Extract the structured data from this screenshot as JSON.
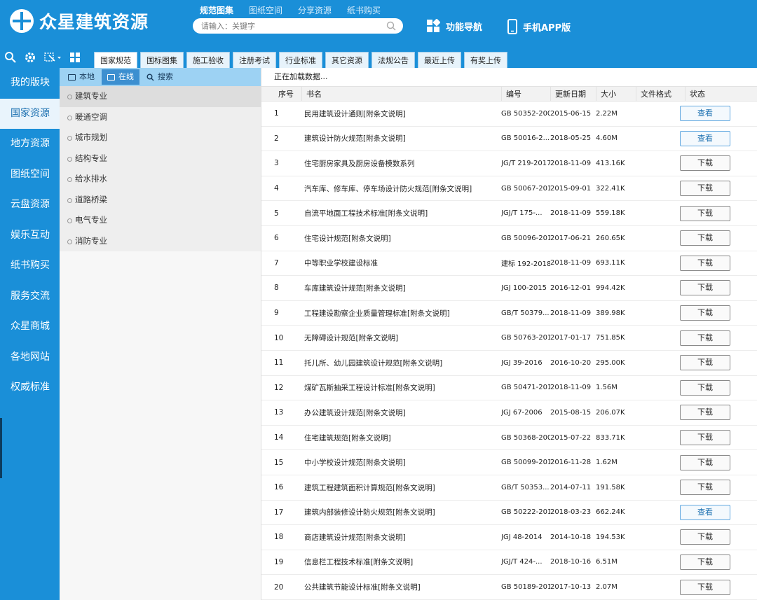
{
  "header": {
    "logo_text": "众星建筑资源",
    "search_tabs": [
      "规范图集",
      "图纸空间",
      "分享资源",
      "纸书购买"
    ],
    "search_placeholder": "请输入：关键字",
    "func_nav": "功能导航",
    "app_label": "手机APP版"
  },
  "tabs": [
    "国家规范",
    "国标图集",
    "施工验收",
    "注册考试",
    "行业标准",
    "其它资源",
    "法规公告",
    "最近上传",
    "有奖上传"
  ],
  "sidebar": [
    "我的版块",
    "国家资源",
    "地方资源",
    "图纸空间",
    "云盘资源",
    "娱乐互动",
    "纸书购买",
    "服务交流",
    "众星商城",
    "各地网站",
    "权威标准"
  ],
  "cat_tabs": [
    "本地",
    "在线",
    "搜索"
  ],
  "categories": [
    "建筑专业",
    "暖通空调",
    "城市规划",
    "结构专业",
    "给水排水",
    "道路桥梁",
    "电气专业",
    "消防专业"
  ],
  "loading_text": "正在加载数据...",
  "columns": [
    "序号",
    "书名",
    "编号",
    "更新日期",
    "大小",
    "文件格式",
    "状态"
  ],
  "rows": [
    {
      "no": "1",
      "name": "民用建筑设计通则[附条文说明]",
      "code": "GB 50352-2005",
      "date": "2015-06-15",
      "size": "2.22M",
      "action": "查看"
    },
    {
      "no": "2",
      "name": "建筑设计防火规范[附条文说明]",
      "code": "GB 50016-2...",
      "date": "2018-05-25",
      "size": "4.60M",
      "action": "查看"
    },
    {
      "no": "3",
      "name": "住宅厨房家具及厨房设备模数系列",
      "code": "JG/T 219-2017",
      "date": "2018-11-09",
      "size": "413.16K",
      "action": "下载"
    },
    {
      "no": "4",
      "name": "汽车库、修车库、停车场设计防火规范[附条文说明]",
      "code": "GB 50067-2014",
      "date": "2015-09-01",
      "size": "322.41K",
      "action": "下载"
    },
    {
      "no": "5",
      "name": "自流平地面工程技术标准[附条文说明]",
      "code": "JGJ/T 175-...",
      "date": "2018-11-09",
      "size": "559.18K",
      "action": "下载"
    },
    {
      "no": "6",
      "name": "住宅设计规范[附条文说明]",
      "code": "GB 50096-2011",
      "date": "2017-06-21",
      "size": "260.65K",
      "action": "下载"
    },
    {
      "no": "7",
      "name": "中等职业学校建设标准",
      "code": "建标 192-2018",
      "date": "2018-11-09",
      "size": "693.11K",
      "action": "下载"
    },
    {
      "no": "8",
      "name": "车库建筑设计规范[附条文说明]",
      "code": "JGJ 100-2015",
      "date": "2016-12-01",
      "size": "994.42K",
      "action": "下载"
    },
    {
      "no": "9",
      "name": "工程建设勘察企业质量管理标准[附条文说明]",
      "code": "GB/T 50379...",
      "date": "2018-11-09",
      "size": "389.98K",
      "action": "下载"
    },
    {
      "no": "10",
      "name": "无障碍设计规范[附条文说明]",
      "code": "GB 50763-2012",
      "date": "2017-01-17",
      "size": "751.85K",
      "action": "下载"
    },
    {
      "no": "11",
      "name": "托儿所、幼儿园建筑设计规范[附条文说明]",
      "code": "JGJ 39-2016",
      "date": "2016-10-20",
      "size": "295.00K",
      "action": "下载"
    },
    {
      "no": "12",
      "name": "煤矿瓦斯抽采工程设计标准[附条文说明]",
      "code": "GB 50471-2018",
      "date": "2018-11-09",
      "size": "1.56M",
      "action": "下载"
    },
    {
      "no": "13",
      "name": "办公建筑设计规范[附条文说明]",
      "code": "JGJ 67-2006",
      "date": "2015-08-15",
      "size": "206.07K",
      "action": "下载"
    },
    {
      "no": "14",
      "name": "住宅建筑规范[附条文说明]",
      "code": "GB 50368-2005",
      "date": "2015-07-22",
      "size": "833.71K",
      "action": "下载"
    },
    {
      "no": "15",
      "name": "中小学校设计规范[附条文说明]",
      "code": "GB 50099-2011",
      "date": "2016-11-28",
      "size": "1.62M",
      "action": "下载"
    },
    {
      "no": "16",
      "name": "建筑工程建筑面积计算规范[附条文说明]",
      "code": "GB/T 50353...",
      "date": "2014-07-11",
      "size": "191.58K",
      "action": "下载"
    },
    {
      "no": "17",
      "name": "建筑内部装修设计防火规范[附条文说明]",
      "code": "GB 50222-2017",
      "date": "2018-03-23",
      "size": "662.24K",
      "action": "查看"
    },
    {
      "no": "18",
      "name": "商店建筑设计规范[附条文说明]",
      "code": "JGJ 48-2014",
      "date": "2014-10-18",
      "size": "194.53K",
      "action": "下载"
    },
    {
      "no": "19",
      "name": "信息栏工程技术标准[附条文说明]",
      "code": "JGJ/T 424-...",
      "date": "2018-10-16",
      "size": "6.51M",
      "action": "下载"
    },
    {
      "no": "20",
      "name": "公共建筑节能设计标准[附条文说明]",
      "code": "GB 50189-2015",
      "date": "2017-10-13",
      "size": "2.07M",
      "action": "下载"
    }
  ],
  "colors": {
    "brand": "#1a8fd8",
    "view_button": "#62a8e0"
  },
  "icons": [
    "logo-icon",
    "search-icon",
    "settings-icon",
    "cut-tool-icon",
    "grid-icon",
    "phone-icon",
    "function-nav-icon"
  ]
}
